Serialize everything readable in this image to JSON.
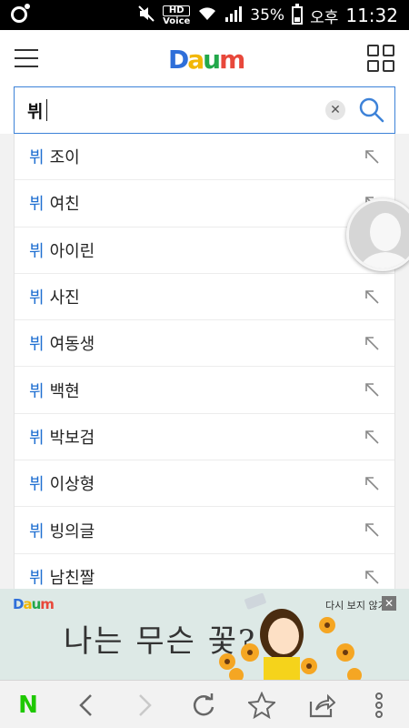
{
  "status_bar": {
    "battery_percent": "35%",
    "ampm": "오후",
    "time": "11:32",
    "hd_label": "HD",
    "voice_label": "Voice"
  },
  "header": {
    "logo_letters": [
      "D",
      "a",
      "u",
      "m"
    ],
    "logo_colors": [
      "#2f6fd9",
      "#f2b705",
      "#22a84a",
      "#e8483b"
    ]
  },
  "search": {
    "query": "뷔",
    "clear_symbol": "✕"
  },
  "suggestions": [
    {
      "highlight": "뷔",
      "rest": "조이"
    },
    {
      "highlight": "뷔",
      "rest": "여친"
    },
    {
      "highlight": "뷔",
      "rest": "아이린"
    },
    {
      "highlight": "뷔",
      "rest": "사진"
    },
    {
      "highlight": "뷔",
      "rest": "여동생"
    },
    {
      "highlight": "뷔",
      "rest": "백현"
    },
    {
      "highlight": "뷔",
      "rest": "박보검"
    },
    {
      "highlight": "뷔",
      "rest": "이상형"
    },
    {
      "highlight": "뷔",
      "rest": "빙의글"
    },
    {
      "highlight": "뷔",
      "rest": "남친짤"
    }
  ],
  "ad": {
    "logo": "Daum",
    "headline": "나는 무슨 꽃?",
    "dismiss_label": "다시 보지 않기",
    "close_symbol": "✕"
  },
  "bottom_bar": {
    "naver_label": "N"
  },
  "colors": {
    "accent": "#3d82d8",
    "highlight": "#1f6fd1",
    "naver_green": "#1ec800"
  }
}
